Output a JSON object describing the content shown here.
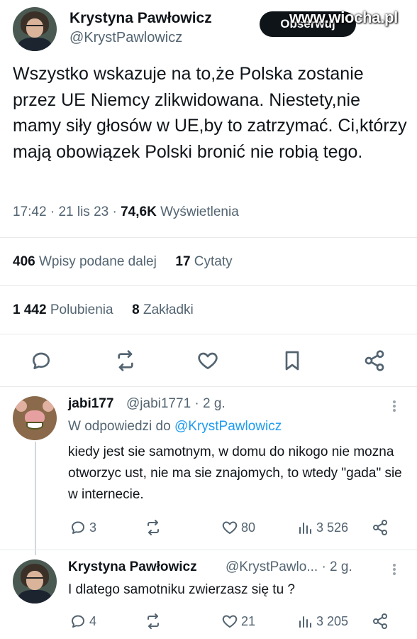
{
  "tweet": {
    "author_name": "Krystyna Pawłowicz",
    "author_handle": "@KrystPawlowicz",
    "follow_label": "Obserwuj",
    "watermark": "www.wiocha.pl",
    "text": "Wszystko wskazuje na to,że Polska zostanie przez UE Niemcy zlikwidowana. Niestety,nie mamy siły głosów w UE,by to zatrzymać. Ci,którzy mają obowiązek Polski bronić nie robią tego.",
    "time": "17:42",
    "date": "21 lis 23",
    "views_count": "74,6K",
    "views_label": "Wyświetlenia",
    "reposts_count": "406",
    "reposts_label": "Wpisy podane dalej",
    "quotes_count": "17",
    "quotes_label": "Cytaty",
    "likes_count": "1 442",
    "likes_label": "Polubienia",
    "bookmarks_count": "8",
    "bookmarks_label": "Zakładki"
  },
  "actions": {
    "icons": [
      "reply-icon",
      "retweet-icon",
      "heart-icon",
      "bookmark-icon",
      "share-icon"
    ]
  },
  "replies": [
    {
      "name": "jabi177",
      "handle": "@jabi1771",
      "age": "· 2 g.",
      "reply_to_prefix": "W odpowiedzi do",
      "reply_to_handle": "@KrystPawlowicz",
      "text": "kiedy jest sie samotnym, w domu do nikogo nie mozna otworzyc ust, nie ma sie znajomych, to wtedy \"gada\" sie w internecie.",
      "replies": "3",
      "retweets": "",
      "likes": "80",
      "views": "3 526"
    },
    {
      "name": "Krystyna Pawłowicz",
      "handle": "@KrystPawlo...",
      "age": "· 2 g.",
      "text": "I dlatego samotniku zwierzasz się tu ?",
      "replies": "4",
      "retweets": "",
      "likes": "21",
      "views": "3 205"
    }
  ]
}
